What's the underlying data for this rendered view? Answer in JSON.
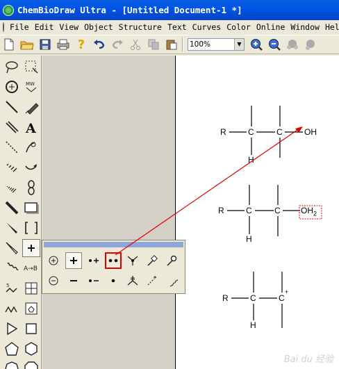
{
  "window": {
    "title": "ChemBioDraw Ultra - [Untitled Document-1 *]"
  },
  "menu": [
    "File",
    "Edit",
    "View",
    "Object",
    "Structure",
    "Text",
    "Curves",
    "Color",
    "Online",
    "Window",
    "Hel"
  ],
  "toolbar": {
    "zoom_value": "100%"
  },
  "structures": {
    "one": {
      "r": "R",
      "c1": "C",
      "c2": "C",
      "h": "H",
      "oh": "OH"
    },
    "two": {
      "r": "R",
      "c1": "C",
      "c2": "C",
      "h": "H",
      "oh2": "OH",
      "oh2_sub": "2"
    },
    "three": {
      "r": "R",
      "c1": "C",
      "c2": "C",
      "plus": "+",
      "h": "H"
    }
  },
  "watermark": "Bai du 经验",
  "colors": {
    "titlebar": "#0055e5",
    "highlight": "#e00000",
    "arrow": "#e00000",
    "flyout_bar": "#8ea6d8"
  }
}
